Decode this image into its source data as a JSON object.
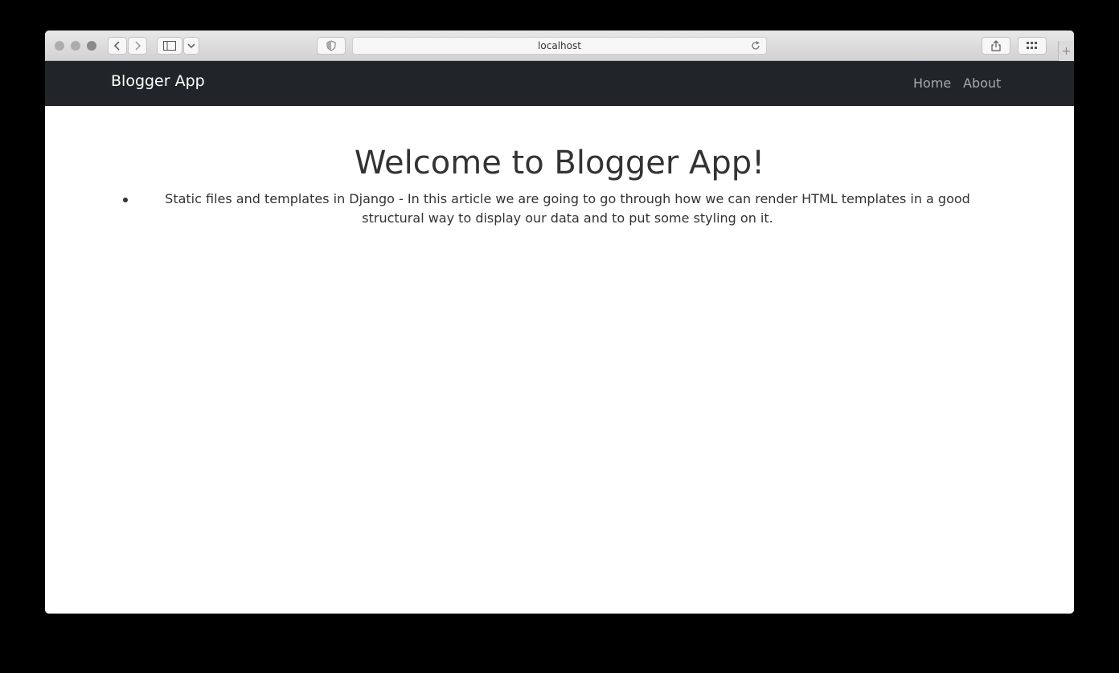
{
  "browser": {
    "url": "localhost"
  },
  "navbar": {
    "brand": "Blogger App",
    "links": [
      {
        "label": "Home"
      },
      {
        "label": "About"
      }
    ]
  },
  "main": {
    "heading": "Welcome to Blogger App!",
    "articles": [
      {
        "text": "Static files and templates in Django - In this article we are going to go through how we can render HTML templates in a good structural way to display our data and to put some styling on it."
      }
    ]
  },
  "colors": {
    "navbar_bg": "#212529",
    "brand_text": "#ffffff",
    "nav_link_text": "#a8a9ab",
    "body_text": "#333333"
  }
}
